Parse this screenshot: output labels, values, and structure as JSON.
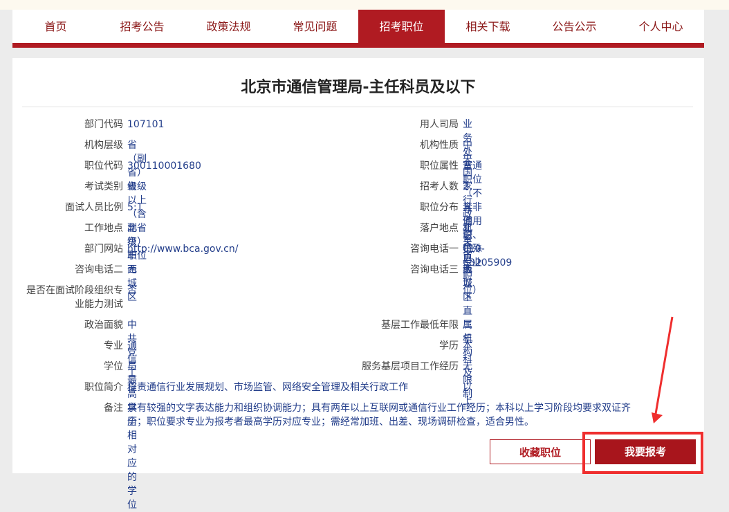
{
  "nav": {
    "items": [
      {
        "label": "首页"
      },
      {
        "label": "招考公告"
      },
      {
        "label": "政策法规"
      },
      {
        "label": "常见问题"
      },
      {
        "label": "招考职位",
        "active": true
      },
      {
        "label": "相关下载"
      },
      {
        "label": "公告公示"
      },
      {
        "label": "个人中心"
      }
    ]
  },
  "page": {
    "title": "北京市通信管理局-主任科员及以下"
  },
  "fields": {
    "dept_code": {
      "label": "部门代码",
      "value": "107101"
    },
    "hiring_division": {
      "label": "用人司局",
      "value": "业务处室"
    },
    "org_level": {
      "label": "机构层级",
      "value": "省（副省）级"
    },
    "org_nature": {
      "label": "机构性质",
      "value": "中央国家行政机关省级以下直属机构"
    },
    "position_code": {
      "label": "职位代码",
      "value": "300110001680"
    },
    "position_attr": {
      "label": "职位属性",
      "value": "普通职位（不含非通用语、特殊专业职位）"
    },
    "exam_type": {
      "label": "考试类别",
      "value": "省级以上（含副省级）职位"
    },
    "hire_count": {
      "label": "招考人数",
      "value": "2"
    },
    "interview_ratio": {
      "label": "面试人员比例",
      "value": "5:1"
    },
    "position_dist": {
      "label": "职位分布",
      "value": "其他职位"
    },
    "work_location": {
      "label": "工作地点",
      "value": "北京市西城区"
    },
    "hukou_location": {
      "label": "落户地点",
      "value": "北京市西城区"
    },
    "dept_website": {
      "label": "部门网站",
      "value": "http://www.bca.gov.cn/"
    },
    "phone1": {
      "label": "咨询电话一",
      "value": "010-68205909"
    },
    "phone2": {
      "label": "咨询电话二",
      "value": "无"
    },
    "phone3": {
      "label": "咨询电话三",
      "value": "无"
    },
    "pro_test": {
      "label_line1": "是否在面试阶段组织专",
      "label_line2": "业能力测试",
      "value": "否"
    },
    "political": {
      "label": "政治面貌",
      "value": "中共党员"
    },
    "min_grassroots": {
      "label": "基层工作最低年限",
      "value": "二年"
    },
    "major": {
      "label": "专业",
      "value": "通信工程"
    },
    "education": {
      "label": "学历",
      "value": "本科及以上"
    },
    "degree": {
      "label": "学位",
      "value": "与最高学历相对应的学位"
    },
    "service_exp": {
      "label": "服务基层项目工作经历",
      "value": "无限制"
    },
    "intro": {
      "label": "职位简介",
      "value": "负责通信行业发展规划、市场监管、网络安全管理及相关行政工作"
    },
    "notes": {
      "label": "备注",
      "line1": "具有较强的文字表达能力和组织协调能力；具有两年以上互联网或通信行业工作经历；本科以上学习阶段均要求双证齐",
      "line2": "全；职位要求专业为报考者最高学历对应专业；需经常加班、出差、现场调研检查，适合男性。"
    }
  },
  "buttons": {
    "favorite": "收藏职位",
    "apply": "我要报考"
  },
  "colors": {
    "brand_red": "#b01b22",
    "value_blue": "#223d8a",
    "highlight_red": "#ef2e2e"
  }
}
